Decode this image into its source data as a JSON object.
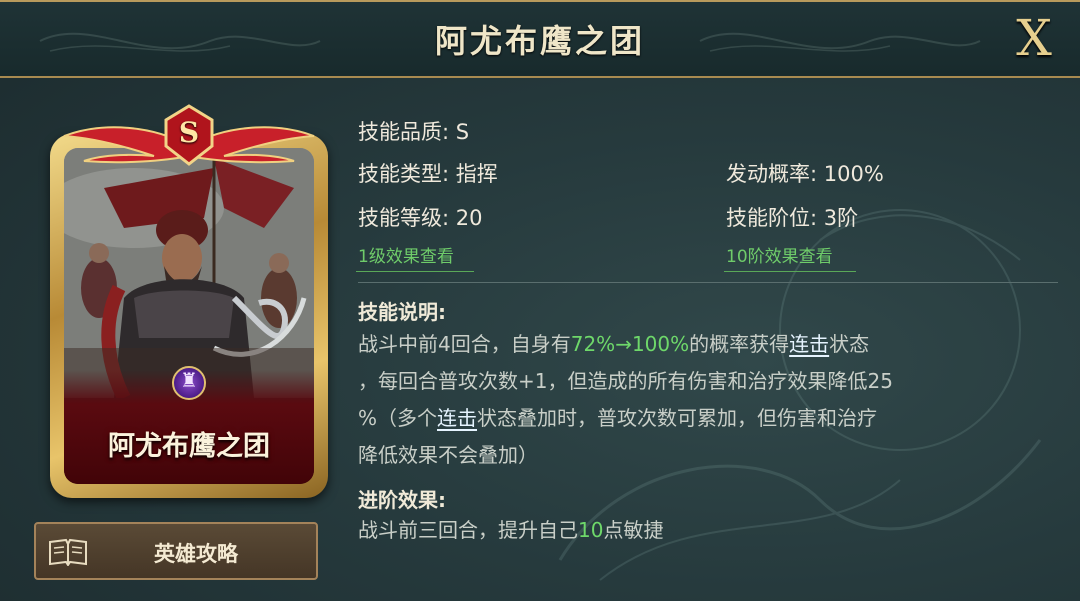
{
  "window": {
    "title": "阿尤布鹰之团",
    "close_label": "X"
  },
  "card": {
    "grade": "S",
    "name": "阿尤布鹰之团",
    "emblem_icon": "faction-emblem-icon"
  },
  "guide_button": {
    "label": "英雄攻略",
    "icon": "book-icon"
  },
  "skill": {
    "quality": "技能品质: S",
    "type": "技能类型: 指挥",
    "trigger_rate": "发动概率: 100%",
    "level": "技能等级: 20",
    "rank": "技能阶位: 3阶",
    "level1_link": "1级效果查看",
    "rank10_link": "10阶效果查看"
  },
  "description": {
    "heading": "技能说明:",
    "line1_a": "战斗中前4回合，自身有",
    "line1_hl": "72%→100%",
    "line1_b": "的概率获得",
    "line1_link": "连击",
    "line1_c": "状态",
    "line2": "，每回合普攻次数+1，但造成的所有伤害和治疗效果降低25",
    "line3_a": "%（多个",
    "line3_link": "连击",
    "line3_b": "状态叠加时，普攻次数可累加，但伤害和治疗",
    "line4": "降低效果不会叠加）"
  },
  "advance": {
    "heading": "进阶效果:",
    "text_a": "战斗前三回合，提升自己",
    "text_hl": "10",
    "text_b": "点敏捷"
  },
  "colors": {
    "highlight_green": "#6ed86a",
    "link_green": "#6fcc6a",
    "gold": "#e6cf8e",
    "background": "#263a3d"
  }
}
